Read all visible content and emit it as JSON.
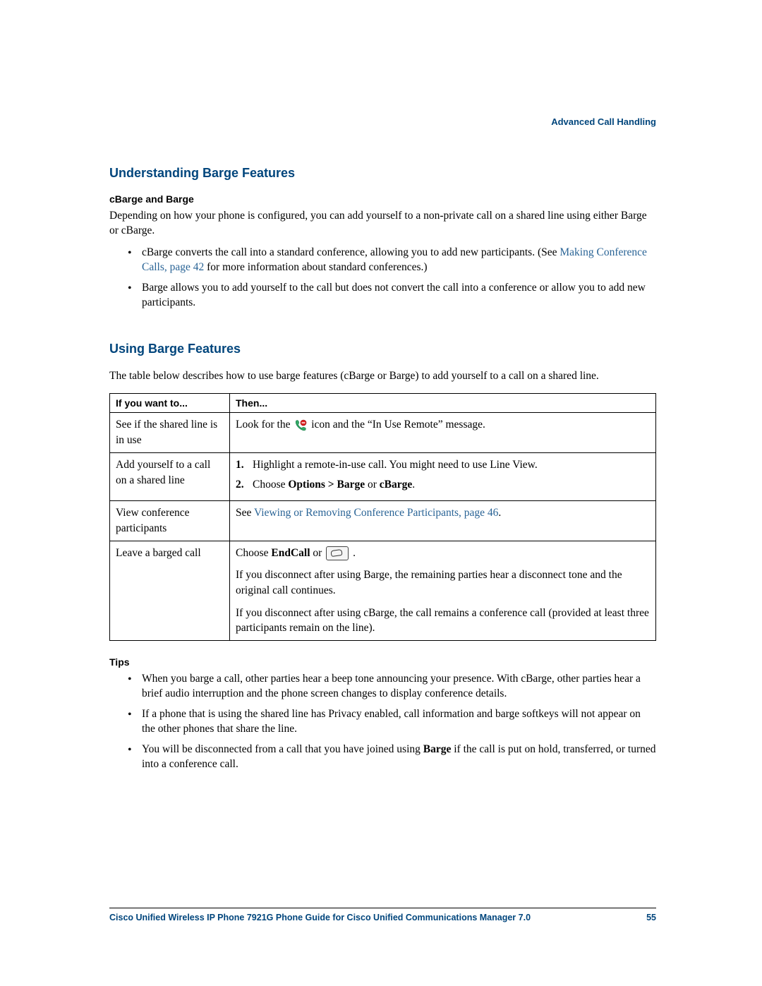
{
  "header": {
    "running": "Advanced Call Handling"
  },
  "section1": {
    "title": "Understanding Barge Features",
    "sub": "cBarge and Barge",
    "intro": "Depending on how your phone is configured, you can add yourself to a non-private call on a shared line using either Barge or cBarge.",
    "bullet1_pre": "cBarge converts the call into a standard conference, allowing you to add new participants. (See ",
    "bullet1_link": "Making Conference Calls, page 42",
    "bullet1_post": " for more information about standard conferences.)",
    "bullet2": "Barge allows you to add yourself to the call but does not convert the call into a conference or allow you to add new participants."
  },
  "section2": {
    "title": "Using Barge Features",
    "intro": "The table below describes how to use barge features (cBarge or Barge) to add yourself to a call on a shared line.",
    "header_if": "If you want to...",
    "header_then": "Then...",
    "rows": [
      {
        "if": "See if the shared line is in use",
        "then_pre": "Look for the ",
        "icon": "in-use-remote-icon",
        "then_post": " icon and the “In Use Remote” message."
      },
      {
        "if": "Add yourself to a call on a shared line",
        "step1": "Highlight a remote-in-use call. You might need to use Line View.",
        "step2_pre": "Choose ",
        "step2_bold": "Options > Barge",
        "step2_mid": " or ",
        "step2_bold2": "cBarge",
        "step2_post": "."
      },
      {
        "if": "View conference participants",
        "then_pre": "See ",
        "link": "Viewing or Removing Conference Participants, page 46",
        "then_post": "."
      },
      {
        "if": "Leave a barged call",
        "line1_pre": "Choose ",
        "line1_bold": "EndCall",
        "line1_mid": " or ",
        "line1_post": ".",
        "line2": "If you disconnect after using Barge, the remaining parties hear a disconnect tone and the original call continues.",
        "line3": "If you disconnect after using cBarge, the call remains a conference call (provided at least three participants remain on the line)."
      }
    ]
  },
  "tips": {
    "title": "Tips",
    "t1": "When you barge a call, other parties hear a beep tone announcing your presence. With cBarge, other parties hear a brief audio interruption and the phone screen changes to display conference details.",
    "t2": "If a phone that is using the shared line has Privacy enabled, call information and barge softkeys will not appear on the other phones that share the line.",
    "t3_pre": "You will be disconnected from a call that you have joined using ",
    "t3_bold": "Barge",
    "t3_post": " if the call is put on hold, transferred, or turned into a conference call."
  },
  "footer": {
    "title": "Cisco Unified Wireless IP Phone 7921G Phone Guide for Cisco Unified Communications Manager 7.0",
    "page": "55"
  }
}
